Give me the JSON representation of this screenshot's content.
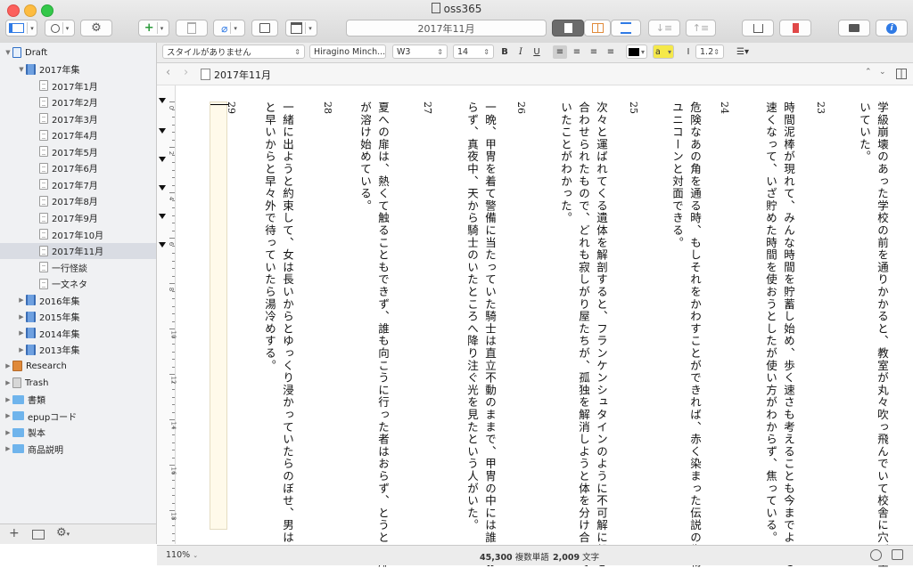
{
  "window": {
    "title": "oss365"
  },
  "toolbar": {
    "title_field": "2017年11月",
    "add_symbol": "+"
  },
  "format_bar": {
    "style": "スタイルがありません",
    "font_family": "Hiragino Minch...",
    "font_weight": "W3",
    "font_size": "14",
    "bold": "B",
    "italic": "I",
    "underline": "U",
    "highlight": "a",
    "line_spacing": "1.2"
  },
  "sidebar": {
    "items": [
      {
        "label": "Draft",
        "icon": "draft-icon",
        "indent": 0,
        "expand": "open"
      },
      {
        "label": "2017年集",
        "icon": "book-icon",
        "indent": 1,
        "expand": "open"
      },
      {
        "label": "2017年1月",
        "icon": "document-icon",
        "indent": 2,
        "expand": "none"
      },
      {
        "label": "2017年2月",
        "icon": "document-icon",
        "indent": 2,
        "expand": "none"
      },
      {
        "label": "2017年3月",
        "icon": "document-icon",
        "indent": 2,
        "expand": "none"
      },
      {
        "label": "2017年4月",
        "icon": "document-icon",
        "indent": 2,
        "expand": "none"
      },
      {
        "label": "2017年5月",
        "icon": "document-icon",
        "indent": 2,
        "expand": "none"
      },
      {
        "label": "2017年6月",
        "icon": "document-icon",
        "indent": 2,
        "expand": "none"
      },
      {
        "label": "2017年7月",
        "icon": "document-icon",
        "indent": 2,
        "expand": "none"
      },
      {
        "label": "2017年8月",
        "icon": "document-icon",
        "indent": 2,
        "expand": "none"
      },
      {
        "label": "2017年9月",
        "icon": "document-icon",
        "indent": 2,
        "expand": "none"
      },
      {
        "label": "2017年10月",
        "icon": "document-icon",
        "indent": 2,
        "expand": "none"
      },
      {
        "label": "2017年11月",
        "icon": "document-icon",
        "indent": 2,
        "expand": "none",
        "selected": true
      },
      {
        "label": "一行怪談",
        "icon": "document-icon",
        "indent": 2,
        "expand": "none"
      },
      {
        "label": "一文ネタ",
        "icon": "document-icon",
        "indent": 2,
        "expand": "none"
      },
      {
        "label": "2016年集",
        "icon": "book-icon",
        "indent": 1,
        "expand": "closed"
      },
      {
        "label": "2015年集",
        "icon": "book-icon",
        "indent": 1,
        "expand": "closed"
      },
      {
        "label": "2014年集",
        "icon": "book-icon",
        "indent": 1,
        "expand": "closed"
      },
      {
        "label": "2013年集",
        "icon": "book-icon",
        "indent": 1,
        "expand": "closed"
      },
      {
        "label": "Research",
        "icon": "research-icon",
        "indent": 0,
        "expand": "closed"
      },
      {
        "label": "Trash",
        "icon": "trash-icon",
        "indent": 0,
        "expand": "closed"
      },
      {
        "label": "書類",
        "icon": "folder-icon",
        "indent": 0,
        "expand": "closed"
      },
      {
        "label": "epupコード",
        "icon": "folder-icon",
        "indent": 0,
        "expand": "closed"
      },
      {
        "label": "製本",
        "icon": "folder-icon",
        "indent": 0,
        "expand": "closed"
      },
      {
        "label": "商品説明",
        "icon": "folder-icon",
        "indent": 0,
        "expand": "closed"
      }
    ]
  },
  "navbar": {
    "title": "2017年11月"
  },
  "ruler": {
    "labels": [
      "0",
      "2",
      "4",
      "6",
      "8",
      "10",
      "12",
      "14",
      "16",
      "18"
    ]
  },
  "document": {
    "columns": [
      {
        "kind": "text",
        "text": "学級崩壊のあった学校の前を通りかかると、教室が丸々吹っ飛んでいて校舎に穴が空"
      },
      {
        "kind": "text",
        "text": "いていた。"
      },
      {
        "kind": "num",
        "text": "23"
      },
      {
        "kind": "text",
        "text": "時間泥棒が現れて、みんな時間を貯蓄し始め、歩く速さも考えることも今までよりも"
      },
      {
        "kind": "text",
        "text": "速くなって、いざ貯めた時間を使おうとしたが使い方がわからず、焦っている。"
      },
      {
        "kind": "num",
        "text": "24"
      },
      {
        "kind": "text",
        "text": "危険なあの角を通る時、もしそれをかわすことができれば、赤く染まった伝説の生物"
      },
      {
        "kind": "text",
        "text": "ユニコーンと対面できる。"
      },
      {
        "kind": "num",
        "text": "25"
      },
      {
        "kind": "text",
        "text": "次々と運ばれてくる遺体を解剖すると、フランケンシュタインのように不可解に繋ぎ"
      },
      {
        "kind": "text",
        "text": "合わせられたもので、どれも寂しがり屋たちが、孤独を解消しようと体を分け合って"
      },
      {
        "kind": "text",
        "text": "いたことがわかった。"
      },
      {
        "kind": "num",
        "text": "26"
      },
      {
        "kind": "text",
        "text": "一晩、甲冑を着て警備に当たっていた騎士は直立不動のままで、甲冑の中には誰もお"
      },
      {
        "kind": "text",
        "text": "らず、真夜中、天から騎士のいたところへ降り注ぐ光を見たという人がいた。"
      },
      {
        "kind": "num",
        "text": "27"
      },
      {
        "kind": "text",
        "text": "夏への扉は、熱くて触ることもできず、誰も向こうに行った者はおらず、とうとう扉"
      },
      {
        "kind": "text",
        "text": "が溶け始めている。"
      },
      {
        "kind": "num",
        "text": "28"
      },
      {
        "kind": "text",
        "text": "一緒に出ようと約束して、女は長いからとゆっくり浸かっていたらのぼせ、男はきっ"
      },
      {
        "kind": "text",
        "text": "と早いからと早々外で待っていたら湯冷めする。"
      },
      {
        "kind": "num",
        "text": "29"
      }
    ]
  },
  "status": {
    "zoom": "110%",
    "word_count": "45,300",
    "word_label": "複数単語",
    "char_count": "2,009",
    "char_label": "文字"
  },
  "colors": {
    "accent_blue": "#2f7ae5",
    "selection": "#d9dce3",
    "draft_bg": "#fffaea"
  }
}
